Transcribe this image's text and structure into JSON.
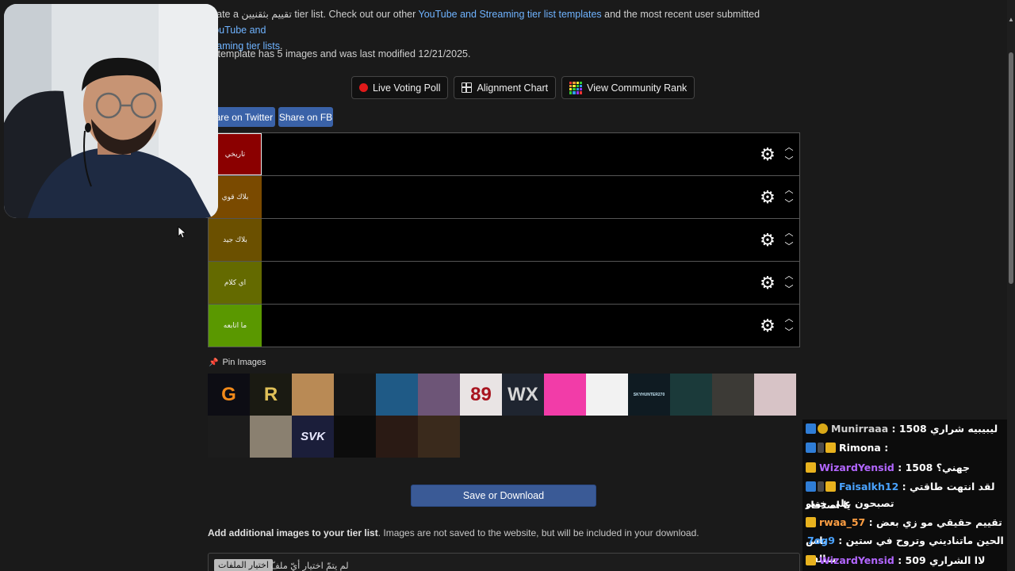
{
  "intro": {
    "t1": "reate a ",
    "t2": "تقييم بثقنيين",
    "t3": " tier list. Check out our other ",
    "link1": "YouTube and Streaming tier list templates",
    "t4": " and the most recent user submitted ",
    "link2a": "YouTube and",
    "link2b": "reaming tier lists",
    "t5": "."
  },
  "info": "is template has 5 images and was last modified 12/21/2025.",
  "buttons": {
    "poll": "Live Voting Poll",
    "alignment": "Alignment Chart",
    "community": "View Community Rank"
  },
  "share": {
    "twitter": "hare on Twitter",
    "fb": "Share on FB"
  },
  "tiers": [
    {
      "label": "تاريخي",
      "color": "#8b0000"
    },
    {
      "label": "بلاك قوي",
      "color": "#7a4a00"
    },
    {
      "label": "بلاك جيد",
      "color": "#6b5000"
    },
    {
      "label": "اي كلام",
      "color": "#646a00"
    },
    {
      "label": "ما اتابعه",
      "color": "#5a9800"
    }
  ],
  "pin_label": "Pin Images",
  "pool": [
    {
      "icon": "g-logo",
      "text": "G",
      "bg": "#0d0d14",
      "fg": "#f28a1a"
    },
    {
      "icon": "r-logo",
      "text": "R",
      "bg": "#1a1a12",
      "fg": "#e0c058"
    },
    {
      "icon": "cartoon-animal",
      "text": "",
      "bg": "#b98a55",
      "fg": "#fff"
    },
    {
      "icon": "gold-emblem",
      "text": "",
      "bg": "#161616",
      "fg": "#d9a23a"
    },
    {
      "icon": "blue-scene",
      "text": "",
      "bg": "#1f5a86",
      "fg": "#fff"
    },
    {
      "icon": "purple-ship",
      "text": "",
      "bg": "#6d5577",
      "fg": "#fff"
    },
    {
      "icon": "89-logo",
      "text": "89",
      "bg": "#e9e4e4",
      "fg": "#a8141f"
    },
    {
      "icon": "wx-logo",
      "text": "WX",
      "bg": "#1f2530",
      "fg": "#d6d6d6"
    },
    {
      "icon": "pink-monkey",
      "text": "",
      "bg": "#f23ca8",
      "fg": "#fff"
    },
    {
      "icon": "bw-face",
      "text": "",
      "bg": "#f2f2f2",
      "fg": "#111"
    },
    {
      "icon": "skyhunter-logo",
      "text": "SKYHUNTER270",
      "bg": "#0f1b22",
      "fg": "#bfe0ef"
    },
    {
      "icon": "teal-emblem",
      "text": "",
      "bg": "#1b3a3a",
      "fg": "#fff"
    },
    {
      "icon": "hooded-figure",
      "text": "",
      "bg": "#3c3a36",
      "fg": "#fff"
    },
    {
      "icon": "anime-character",
      "text": "",
      "bg": "#d7c3c6",
      "fg": "#fff"
    },
    {
      "icon": "red-logo",
      "text": "",
      "bg": "#1c1c1c",
      "fg": "#e02020"
    },
    {
      "icon": "armored-warrior",
      "text": "",
      "bg": "#8a8070",
      "fg": "#fff"
    },
    {
      "icon": "svk-logo",
      "text": "SVK",
      "bg": "#1b1e3a",
      "fg": "#e8e8ff"
    },
    {
      "icon": "wolf-logo",
      "text": "",
      "bg": "#0c0c0c",
      "fg": "#ccc"
    },
    {
      "icon": "brown-logo",
      "text": "",
      "bg": "#2a1a14",
      "fg": "#c87a3a"
    },
    {
      "icon": "game-character",
      "text": "",
      "bg": "#3a2a1c",
      "fg": "#fff"
    }
  ],
  "save_label": "Save or Download",
  "add": {
    "bold": "Add additional images to your tier list",
    "rest": ". Images are not saved to the website, but will be included in your download."
  },
  "file": {
    "button": "اختيار الملفات",
    "label": "لم يتمّ اختيار أيّ ملفّ"
  },
  "chat": [
    {
      "badges": [
        "s",
        "r"
      ],
      "user": "Munirraaa",
      "user_color": "#cfcfcf",
      "text": " : 1508 ليبيبيه شراري"
    },
    {
      "badges": [
        "s",
        "z",
        "g"
      ],
      "user": "Rimona",
      "user_color": "#ffffff",
      "text": " : "
    },
    {
      "badges": [
        "g"
      ],
      "user": "WizardYensid",
      "user_color": "#b266ff",
      "text": " : جهني؟ 1508"
    },
    {
      "badges": [
        "s",
        "z",
        "g"
      ],
      "user": "Faisalkh12",
      "user_color": "#4aa3ff",
      "text": " : لقد انتهت طاقتي يا اصدقاء"
    },
    {
      "badges": [],
      "user": "",
      "user_color": "#ffffff",
      "text": "تصبحون على خيبر"
    },
    {
      "badges": [
        "g"
      ],
      "user": "rwaa_57",
      "user_color": "#ff9f43",
      "text": " : تقييم حقيقي مو زي بعض ناس"
    },
    {
      "badges": [],
      "user": "7og9",
      "user_color": "#4aa3ff",
      "text": " : الحين ماتناديني وتروح في ستين سالفه"
    },
    {
      "badges": [
        "g"
      ],
      "user": "WizardYensid",
      "user_color": "#b266ff",
      "text": " : 509 لاا الشراري"
    }
  ]
}
